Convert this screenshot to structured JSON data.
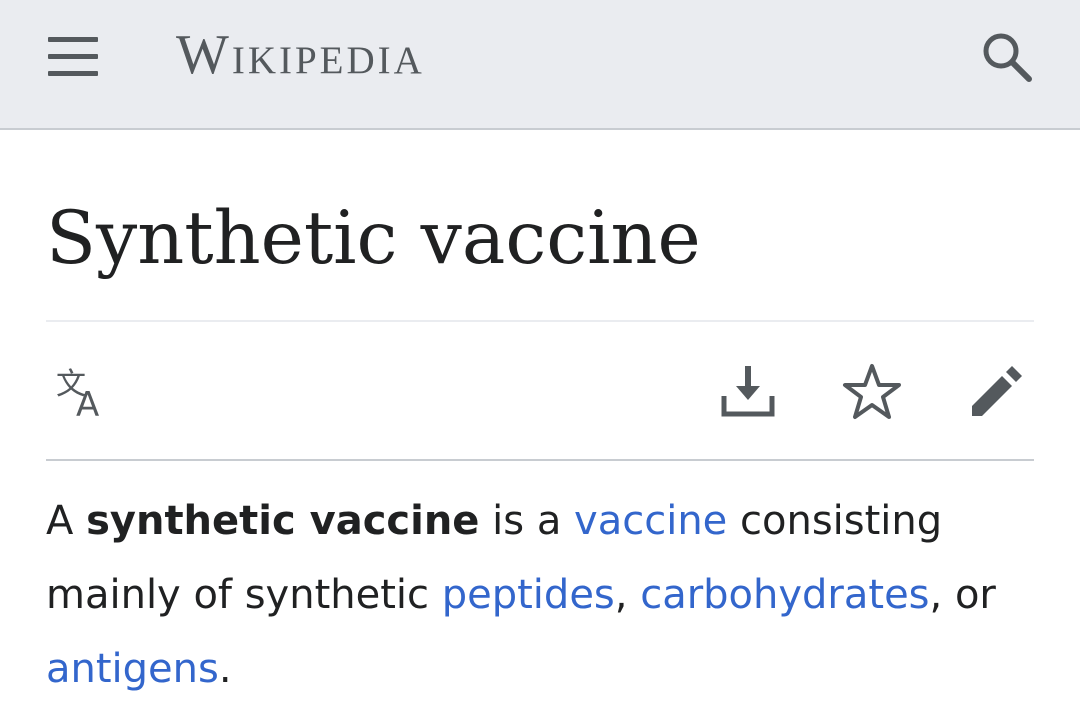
{
  "header": {
    "wordmark": "Wikipedia",
    "menu_icon": "hamburger-menu-icon",
    "search_icon": "search-icon",
    "background": "#eaecf0"
  },
  "article": {
    "title": "Synthetic vaccine",
    "actions": [
      {
        "name": "language",
        "icon": "translate-icon"
      },
      {
        "name": "download",
        "icon": "download-icon"
      },
      {
        "name": "watch",
        "icon": "star-icon"
      },
      {
        "name": "edit",
        "icon": "pencil-icon"
      }
    ],
    "lead": {
      "t1": "A ",
      "bold": "synthetic vaccine",
      "t2": " is a ",
      "link1": "vaccine",
      "t3": " consisting mainly of synthetic ",
      "link2": "peptides",
      "t4": ", ",
      "link3": "carbohydrates",
      "t5": ", or ",
      "link4": "antigens",
      "t6": "."
    }
  },
  "colors": {
    "link": "#3366cc",
    "text": "#202122",
    "icon": "#54595d"
  }
}
